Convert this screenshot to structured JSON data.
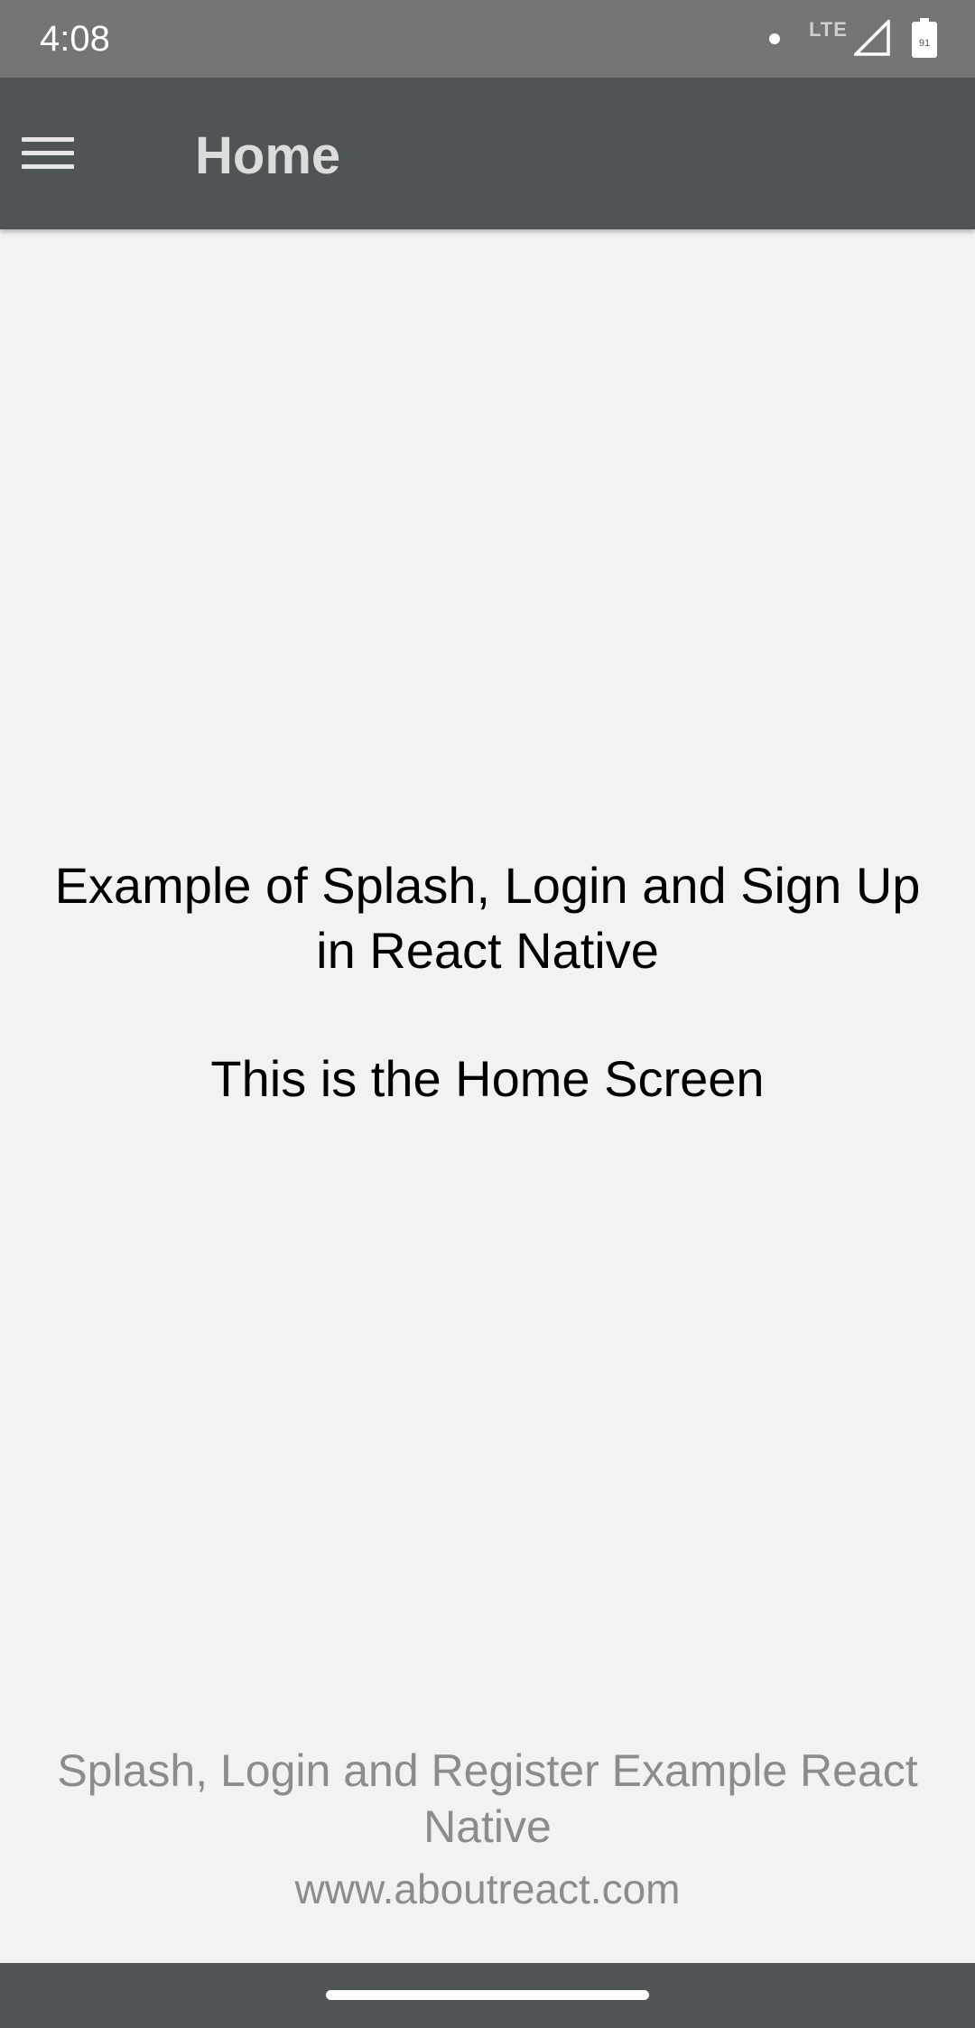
{
  "status_bar": {
    "time": "4:08",
    "network": "LTE",
    "battery_level": "91",
    "icons": [
      "notification-dot-icon",
      "signal-icon",
      "battery-icon"
    ]
  },
  "header": {
    "title": "Home",
    "menu_icon": "hamburger-menu-icon"
  },
  "main": {
    "heading": "Example of Splash, Login and Sign Up in React Native",
    "subheading": "This is the Home Screen"
  },
  "footer": {
    "title": "Splash, Login and Register Example React Native",
    "url": "www.aboutreact.com"
  },
  "colors": {
    "status_bar_bg": "#757575",
    "header_bg": "#4f5457",
    "page_bg": "#f2f2f2",
    "nav_bar_bg": "#4f5457",
    "footer_text": "#8c8c8c"
  }
}
